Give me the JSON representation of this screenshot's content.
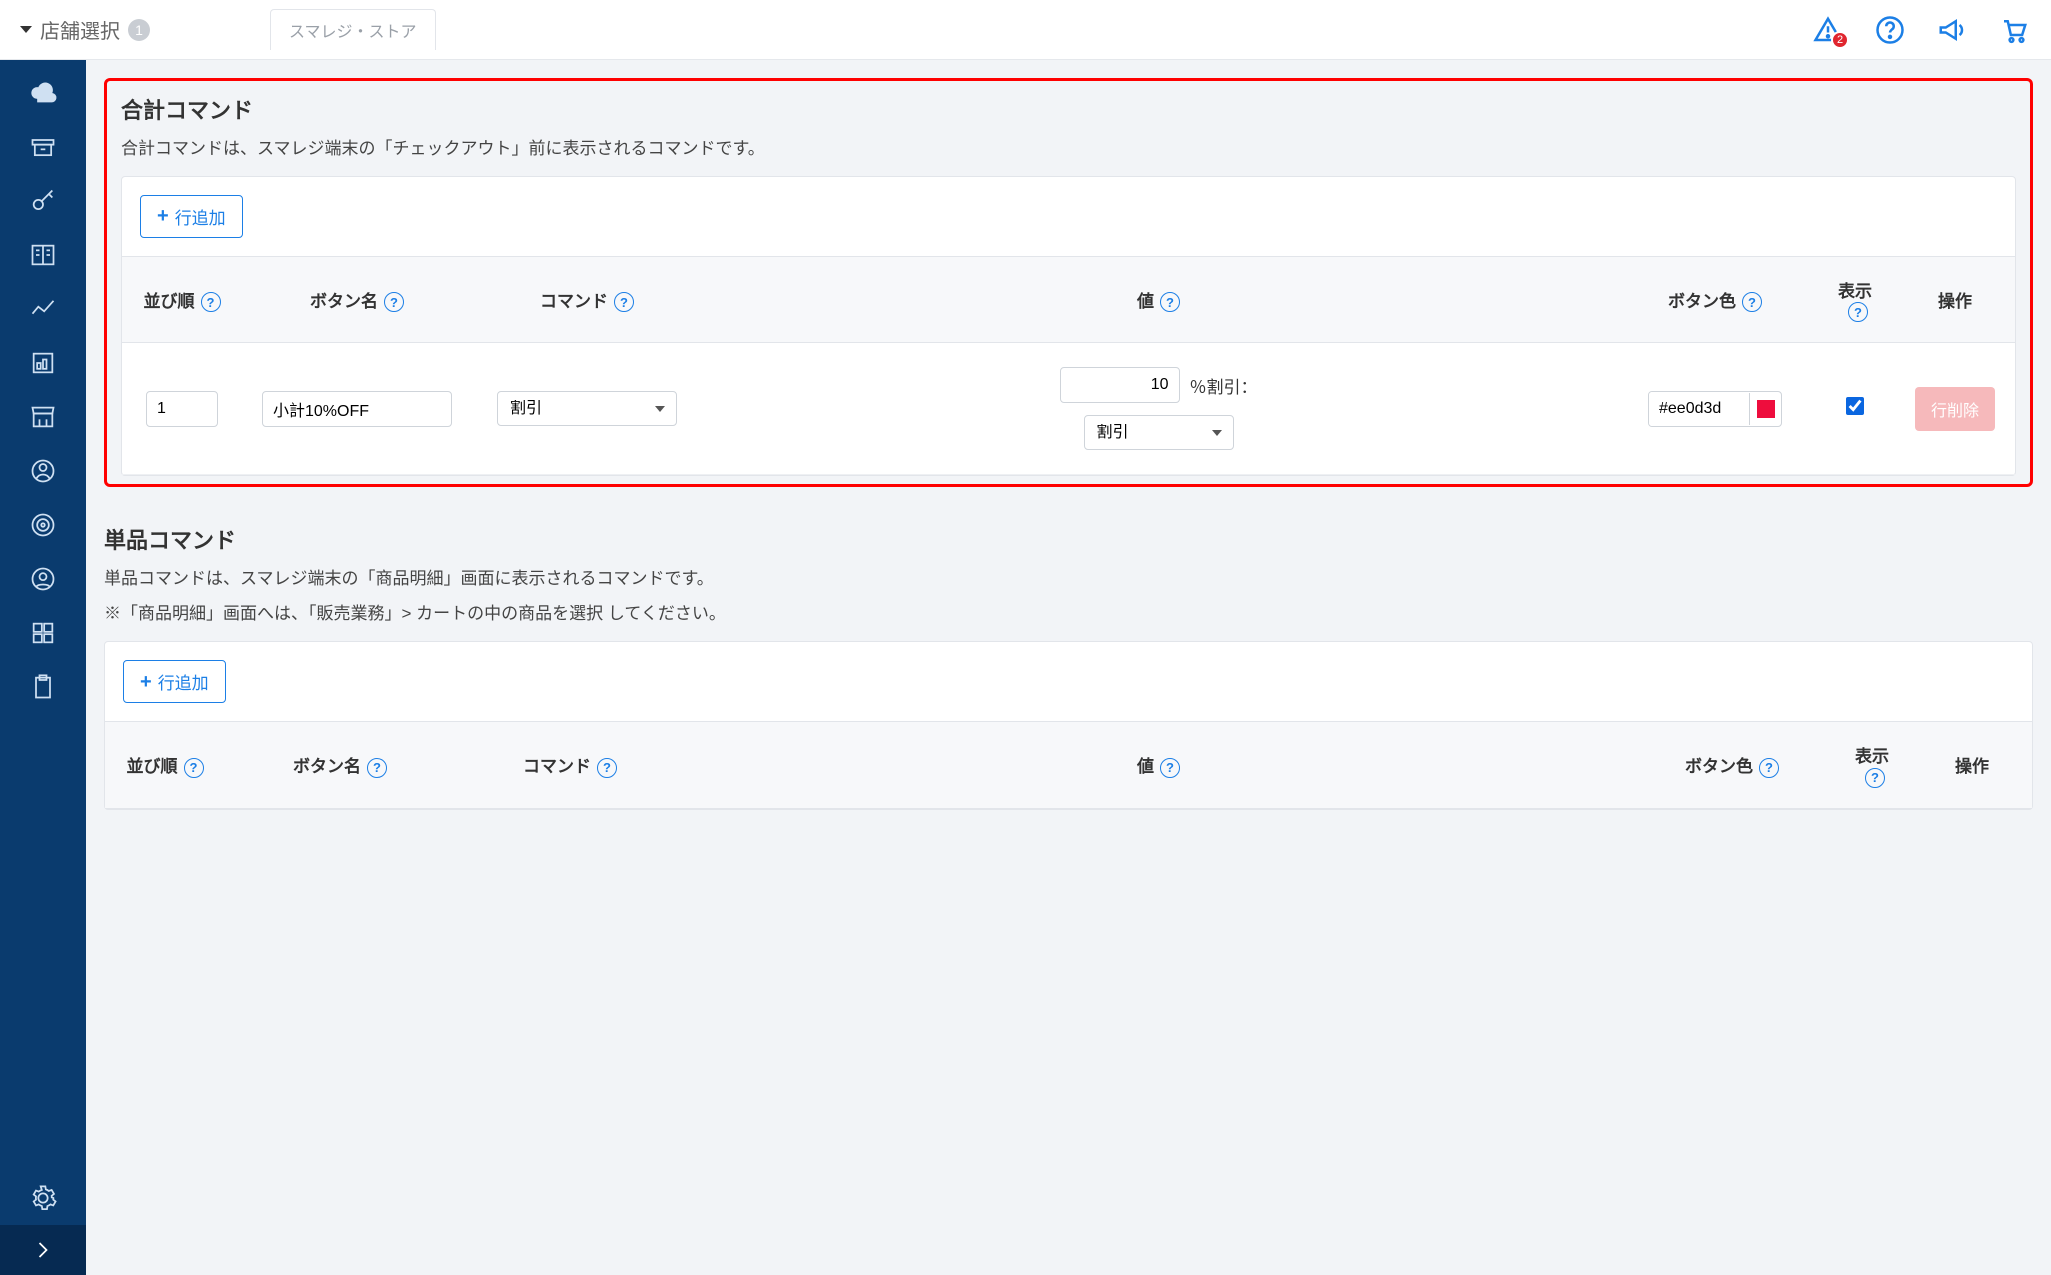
{
  "topbar": {
    "store_select_label": "店舗選択",
    "store_count": "1",
    "tab_label": "スマレジ・ストア",
    "alert_count": "2"
  },
  "sections": {
    "total": {
      "title": "合計コマンド",
      "desc": "合計コマンドは、スマレジ端末の「チェックアウト」前に表示されるコマンドです。",
      "add_row": "行追加",
      "headers": {
        "order": "並び順",
        "name": "ボタン名",
        "command": "コマンド",
        "value": "値",
        "color": "ボタン色",
        "show": "表示",
        "op": "操作"
      },
      "row": {
        "order": "1",
        "name": "小計10%OFF",
        "command_selected": "割引",
        "value_num": "10",
        "value_unit": "％割引：",
        "value_type_selected": "割引",
        "color_hex": "#ee0d3d",
        "show_checked": true,
        "delete_label": "行削除"
      }
    },
    "single": {
      "title": "単品コマンド",
      "desc1": "単品コマンドは、スマレジ端末の「商品明細」画面に表示されるコマンドです。",
      "desc2": "※「商品明細」画面へは、「販売業務」> カートの中の商品を選択 してください。",
      "add_row": "行追加",
      "headers": {
        "order": "並び順",
        "name": "ボタン名",
        "command": "コマンド",
        "value": "値",
        "color": "ボタン色",
        "show": "表示",
        "op": "操作"
      }
    }
  }
}
